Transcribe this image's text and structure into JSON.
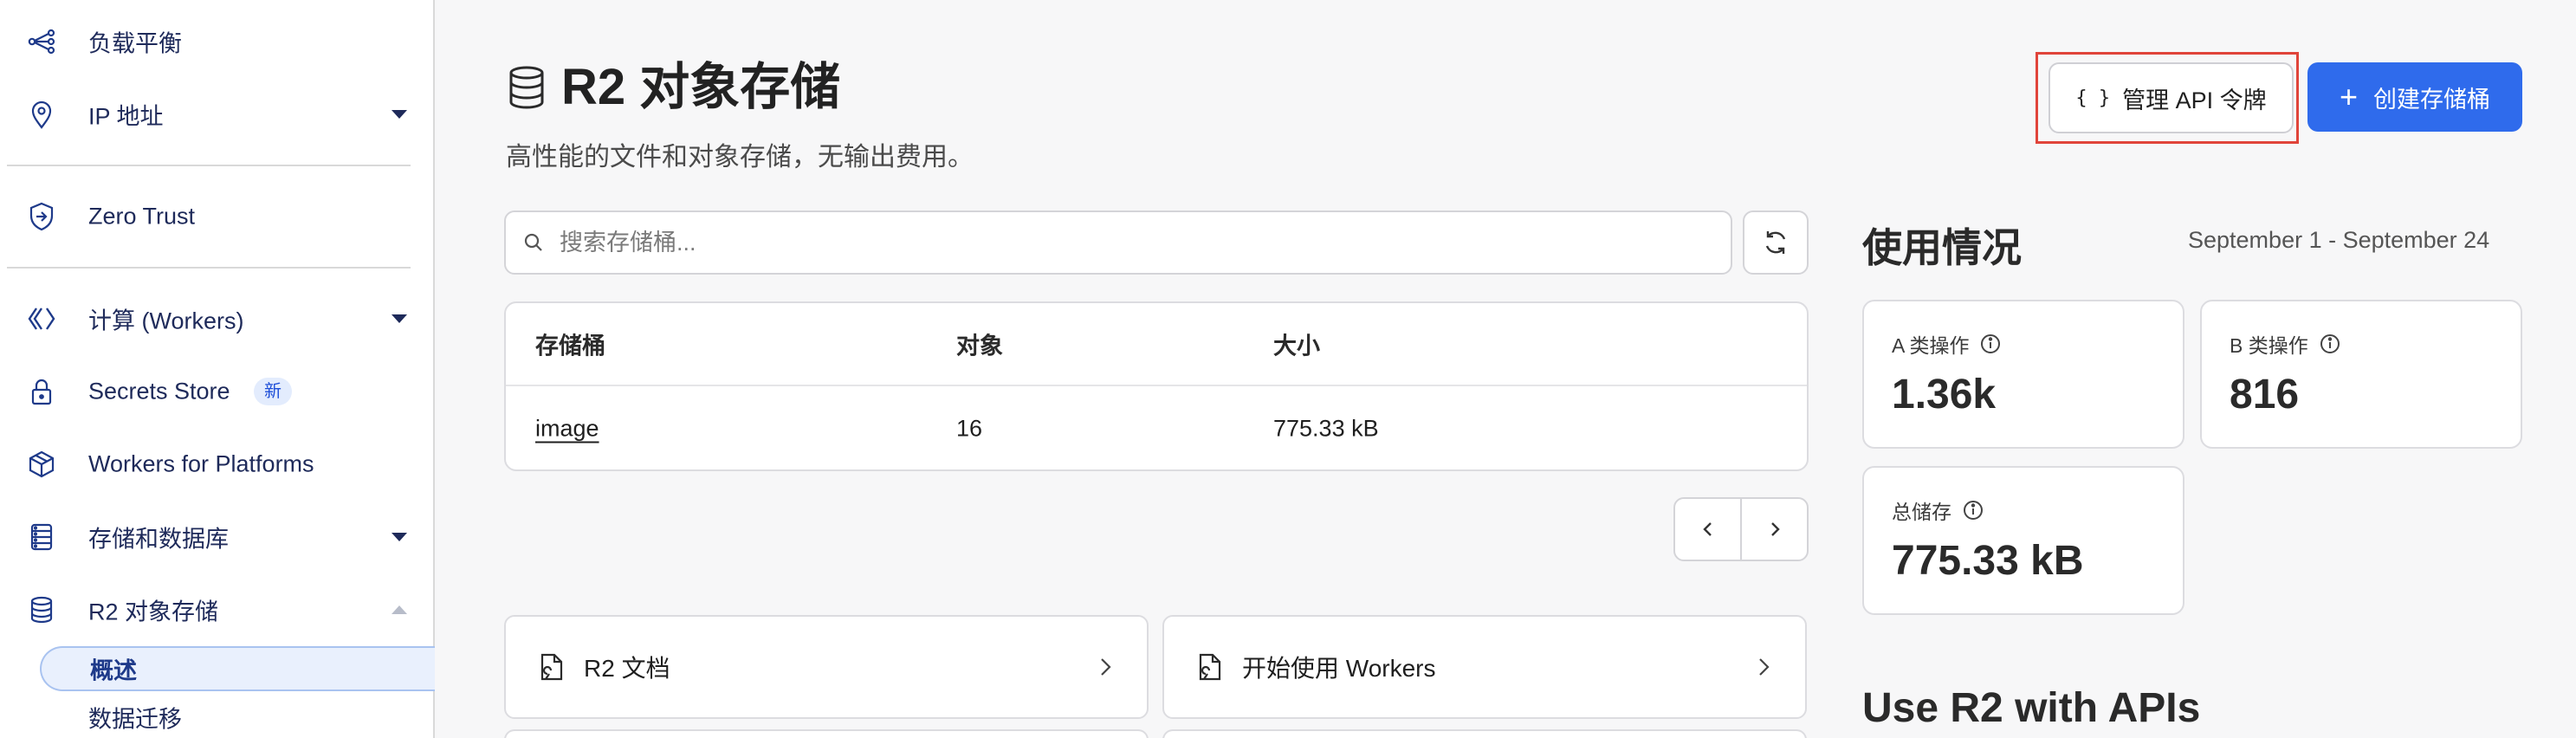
{
  "sidebar": {
    "items": [
      {
        "label": "负载平衡",
        "icon": "load-balancer-icon"
      },
      {
        "label": "IP 地址",
        "icon": "location-pin-icon"
      },
      {
        "label": "Zero Trust",
        "icon": "zero-trust-icon"
      },
      {
        "label": "计算 (Workers)",
        "icon": "workers-icon"
      },
      {
        "label": "Secrets Store",
        "icon": "lock-icon",
        "badge": "新"
      },
      {
        "label": "Workers for Platforms",
        "icon": "cube-icon"
      },
      {
        "label": "存储和数据库",
        "icon": "storage-icon"
      },
      {
        "label": "R2 对象存储",
        "icon": "database-icon"
      }
    ],
    "sub_items": [
      {
        "label": "概述",
        "active": true
      },
      {
        "label": "数据迁移",
        "active": false
      }
    ]
  },
  "header": {
    "title": "R2 对象存储",
    "subtitle": "高性能的文件和对象存储，无输出费用。",
    "api_button": "管理 API 令牌",
    "api_button_icon": "{ }",
    "create_button": "创建存储桶",
    "accent_color": "#2f6bec",
    "highlight_color": "#e0443a"
  },
  "search": {
    "placeholder": "搜索存储桶..."
  },
  "table": {
    "columns": [
      "存储桶",
      "对象",
      "大小"
    ],
    "rows": [
      {
        "name": "image",
        "objects": "16",
        "size": "775.33 kB"
      }
    ]
  },
  "resources": [
    {
      "label": "R2 文档",
      "icon": "document-icon"
    },
    {
      "label": "开始使用 Workers",
      "icon": "document-icon"
    }
  ],
  "usage": {
    "title": "使用情况",
    "range": "September 1 - September 24",
    "stats": [
      {
        "label": "A 类操作",
        "value": "1.36k"
      },
      {
        "label": "B 类操作",
        "value": "816"
      },
      {
        "label": "总储存",
        "value": "775.33 kB"
      }
    ]
  },
  "apis_section": {
    "title": "Use R2 with APIs"
  }
}
